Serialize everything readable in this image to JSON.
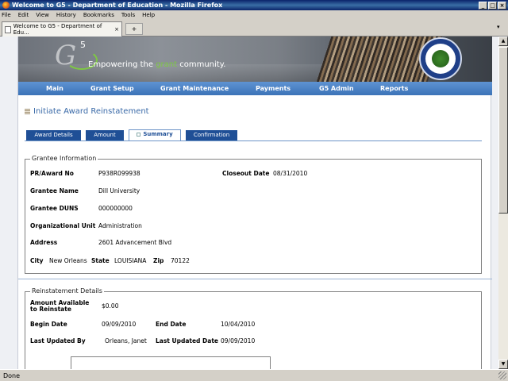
{
  "window": {
    "title": "Welcome to G5 - Department of Education - Mozilla Firefox",
    "min": "_",
    "max": "□",
    "close": "×"
  },
  "menu": [
    "File",
    "Edit",
    "View",
    "History",
    "Bookmarks",
    "Tools",
    "Help"
  ],
  "browser_tab": {
    "label": "Welcome to G5 - Department of Edu...",
    "new_tab": "+"
  },
  "banner": {
    "logo": "G",
    "logo_sup": "5",
    "tagline_pre": "Empowering the ",
    "tagline_hl": "grant",
    "tagline_post": " community."
  },
  "nav": [
    "Main",
    "Grant Setup",
    "Grant Maintenance",
    "Payments",
    "G5 Admin",
    "Reports"
  ],
  "page_title": "Initiate Award Reinstatement",
  "wizard_tabs": [
    "Award Details",
    "Amount",
    "Summary",
    "Confirmation"
  ],
  "grantee": {
    "legend": "Grantee Information",
    "pr_award_label": "PR/Award No",
    "pr_award": "P938R099938",
    "closeout_label": "Closeout Date",
    "closeout": "08/31/2010",
    "name_label": "Grantee Name",
    "name": "Dill University",
    "duns_label": "Grantee DUNS",
    "duns": "000000000",
    "org_label": "Organizational Unit",
    "org": "Administration",
    "address_label": "Address",
    "address": "2601 Advancement Blvd",
    "city_label": "City",
    "city": "New Orleans",
    "state_label": "State",
    "state": "LOUISIANA",
    "zip_label": "Zip",
    "zip": "70122"
  },
  "reinstatement": {
    "legend": "Reinstatement Details",
    "amount_label_1": "Amount Available",
    "amount_label_2": "to Reinstate",
    "amount": "$0.00",
    "begin_label": "Begin Date",
    "begin": "09/09/2010",
    "end_label": "End Date",
    "end": "10/04/2010",
    "updated_by_label": "Last Updated By",
    "updated_by": "Orleans, Janet",
    "updated_date_label": "Last Updated Date",
    "updated_date": "09/09/2010"
  },
  "status": "Done"
}
